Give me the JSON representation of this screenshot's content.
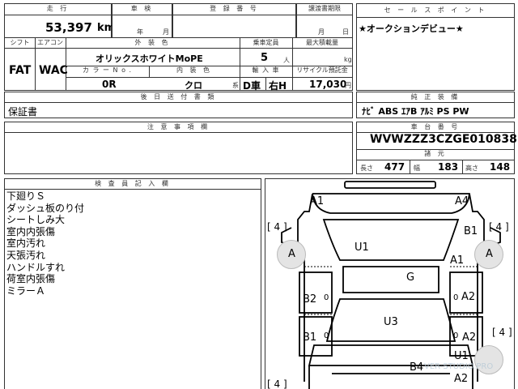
{
  "top_row": {
    "headers": {
      "mileage": "走 行",
      "inspection": "車 検",
      "registration": "登 録 番 号",
      "transfer": "譲渡書期限",
      "sales_point": "セ ー ル ス ポ イ ン ト"
    },
    "mileage_value": "53,397",
    "mileage_unit": "km",
    "inspection_year": "年",
    "inspection_month": "月",
    "transfer_month": "月",
    "transfer_day": "日",
    "sales_point_text": "★オークションデビュー★"
  },
  "second_row": {
    "headers": {
      "shift": "シフト",
      "aircon": "エアコン",
      "exterior_color": "外 装 色",
      "capacity": "乗車定員",
      "max_load": "最大積載量",
      "color_no": "カ ラ ー N o .",
      "interior_color": "内 装 色",
      "import": "輸 入 車",
      "recycle": "リサイクル預託金"
    },
    "shift_value": "FAT",
    "aircon_value": "WAC",
    "exterior_color_value": "オリックスホワイトMoPE",
    "capacity_value": "5",
    "capacity_unit": "人",
    "max_load_unit": "kg",
    "color_no_value": "0R",
    "interior_color_value": "クロ",
    "interior_color_unit": "系",
    "d_car": "D車",
    "right_h": "右H",
    "recycle_value": "17,030",
    "recycle_unit": "円"
  },
  "third_row": {
    "docs_header": "後 日 送 付 書 類",
    "docs_value": "保証書",
    "equipment_header": "純 正 装 備",
    "equipment_value": "ﾅﾋﾞ ABS ｴｱB ｱﾙﾐ PS PW"
  },
  "fourth_row": {
    "notes_header": "注 意 事 項 欄",
    "chassis_header": "車 台 番 号",
    "chassis_value": "WVWZZZ3CZGE010838",
    "dims_header": "諸 元",
    "length_label": "長さ",
    "length_value": "477",
    "width_label": "幅",
    "width_value": "183",
    "height_label": "高さ",
    "height_value": "148"
  },
  "inspector": {
    "header": "検 査 員 記 入 欄",
    "notes": [
      "下廻りＳ",
      "ダッシュ板のり付",
      "シートしみ大",
      "室内内張傷",
      "室内汚れ",
      "天張汚れ",
      "ハンドルすれ",
      "荷室内張傷",
      "ミラーＡ"
    ]
  },
  "diagram": {
    "labels": {
      "front_left": "A1",
      "front_right": "A4",
      "windshield": "U1",
      "roof": "G",
      "rear_glass": "U3",
      "right_front_fender": "B1",
      "right_front_door": "A1",
      "right_rear_door": "A2",
      "left_front_door": "B2",
      "left_rear_door": "B1",
      "right_rear_qtr": "A2",
      "rear_glass_lower": "U1",
      "rear_bumper_left": "B4",
      "rear_bumper_right": "A2",
      "wheel_left": "A",
      "wheel_right": "A",
      "tire_fl": "[ 4 ]",
      "tire_fr": "[ 4 ]",
      "tire_rl": "[ 4 ]",
      "tire_rr": "[ 4 ]",
      "zero_1": "0",
      "zero_2": "0",
      "zero_3": "0",
      "zero_4": "0"
    },
    "watermark": "VER-STUDIO.PRO"
  }
}
